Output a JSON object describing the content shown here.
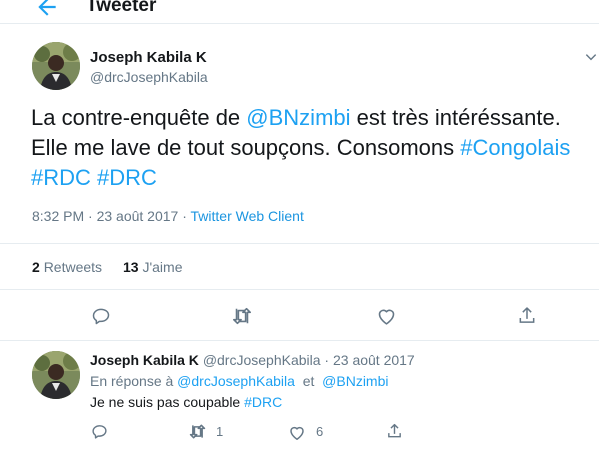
{
  "header": {
    "title": "Tweeter"
  },
  "main_tweet": {
    "name": "Joseph Kabila K",
    "handle": "@drcJosephKabila",
    "text_1": "La contre-enquête de ",
    "mention_1": "@BNzimbi",
    "text_2": " est très intéréssante. Elle me lave de tout soupçons. Consomons ",
    "hashtag_1": "#Congolais",
    "hashtag_2": "#RDC",
    "hashtag_3": "#DRC",
    "timestamp": "8:32 PM · 23 août 2017 · ",
    "client": "Twitter Web Client",
    "retweets_count": "2",
    "retweets_label": "Retweets",
    "likes_count": "13",
    "likes_label": "J'aime"
  },
  "reply_tweet": {
    "name": "Joseph Kabila K",
    "meta": "@drcJosephKabila · 23 août 2017",
    "reply_prefix": "En réponse à ",
    "reply_user_1": "@drcJosephKabila",
    "reply_and": "et",
    "reply_user_2": "@BNzimbi",
    "text": "Je ne suis pas coupable ",
    "hashtag": "#DRC",
    "retweet_count": "1",
    "like_count": "6"
  },
  "colors": {
    "accent": "#1da1f2",
    "muted": "#657786",
    "text": "#14171a",
    "border": "#e6ecf0"
  },
  "icons": [
    "back-arrow-icon",
    "chevron-down-icon",
    "reply-icon",
    "retweet-icon",
    "like-icon",
    "share-icon"
  ]
}
